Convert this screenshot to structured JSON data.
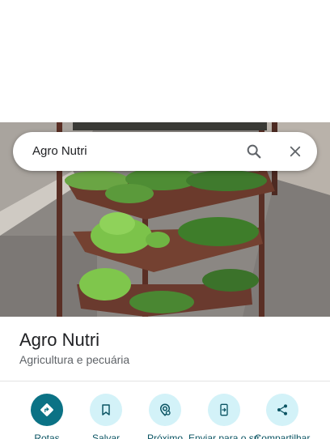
{
  "search": {
    "query": "Agro Nutri",
    "search_icon": "search-icon",
    "close_icon": "close-icon"
  },
  "place": {
    "name": "Agro Nutri",
    "category": "Agricultura e pecuária"
  },
  "actions": [
    {
      "label": "Rotas",
      "icon": "directions-icon"
    },
    {
      "label": "Salvar",
      "icon": "bookmark-icon"
    },
    {
      "label": "Próximo",
      "icon": "nearby-icon"
    },
    {
      "label": "Enviar para o smartphone",
      "icon": "send-to-phone-icon"
    },
    {
      "label": "Compartilhar",
      "icon": "share-icon"
    }
  ],
  "colors": {
    "accent": "#0b7285",
    "action_circle": "#d3f2f8",
    "action_label": "#0b5463"
  }
}
